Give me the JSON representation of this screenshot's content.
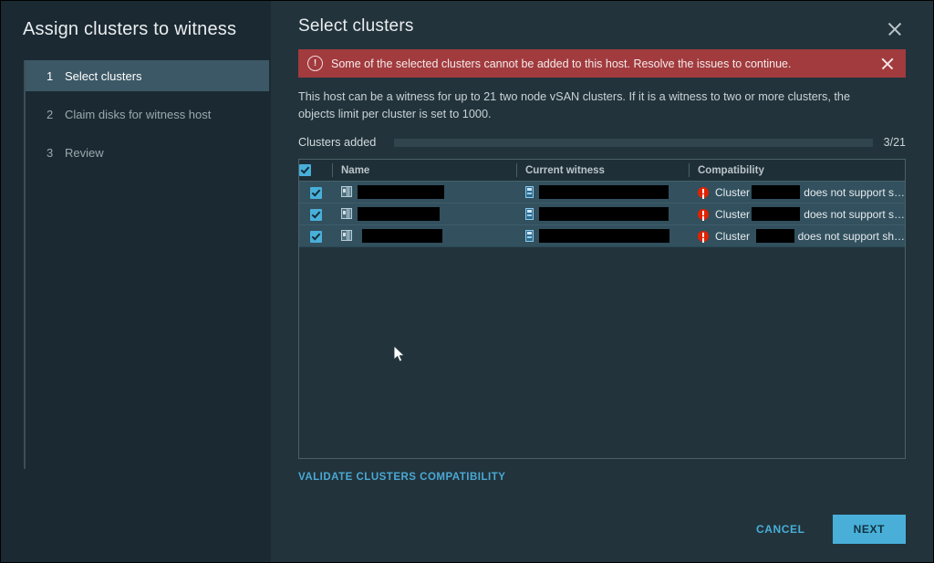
{
  "window": {
    "nav_title": "Assign clusters to witness",
    "content_title": "Select clusters",
    "close_icon": "close-icon"
  },
  "steps": [
    {
      "num": "1",
      "label": "Select clusters",
      "active": true
    },
    {
      "num": "2",
      "label": "Claim disks for witness host",
      "active": false
    },
    {
      "num": "3",
      "label": "Review",
      "active": false
    }
  ],
  "alert": {
    "icon": "error-circle-icon",
    "message": "Some of the selected clusters cannot be added to this host. Resolve the issues to continue.",
    "close_icon": "close-icon",
    "background": "#a13b3e"
  },
  "description": "This host can be a witness for up to 21 two node vSAN clusters. If it is a witness to two or more clusters, the objects limit per cluster is set to 1000.",
  "progress": {
    "label": "Clusters added",
    "count_text": "3/21",
    "value": 3,
    "max": 21,
    "percent": "14.3%",
    "fill_color": "#49afd9",
    "track_color": "#31454e"
  },
  "table": {
    "select_all_checked": true,
    "columns": [
      {
        "key": "check",
        "label": ""
      },
      {
        "key": "name",
        "label": "Name"
      },
      {
        "key": "witness",
        "label": "Current witness"
      },
      {
        "key": "compatibility",
        "label": "Compatibility"
      }
    ],
    "rows": [
      {
        "checked": true,
        "name_redacted": true,
        "name_width": 95,
        "witness_redacted": true,
        "witness_width": 142,
        "compat_prefix": "Cluster",
        "compat_redacted": true,
        "compat_width": 88,
        "compat_suffix": "does not support s…"
      },
      {
        "checked": true,
        "name_redacted": true,
        "name_width": 90,
        "witness_redacted": true,
        "witness_width": 142,
        "compat_prefix": "Cluster",
        "compat_redacted": true,
        "compat_width": 84,
        "compat_suffix": "does not support s…"
      },
      {
        "checked": true,
        "name_redacted": true,
        "name_width": 88,
        "witness_redacted": true,
        "witness_width": 143,
        "compat_prefix": "Cluster",
        "compat_redacted": true,
        "compat_width": 82,
        "compat_suffix": "does not support sh…"
      }
    ]
  },
  "footer": {
    "validate_link": "VALIDATE CLUSTERS COMPATIBILITY",
    "cancel_label": "CANCEL",
    "next_label": "NEXT",
    "primary_color": "#49afd9"
  }
}
